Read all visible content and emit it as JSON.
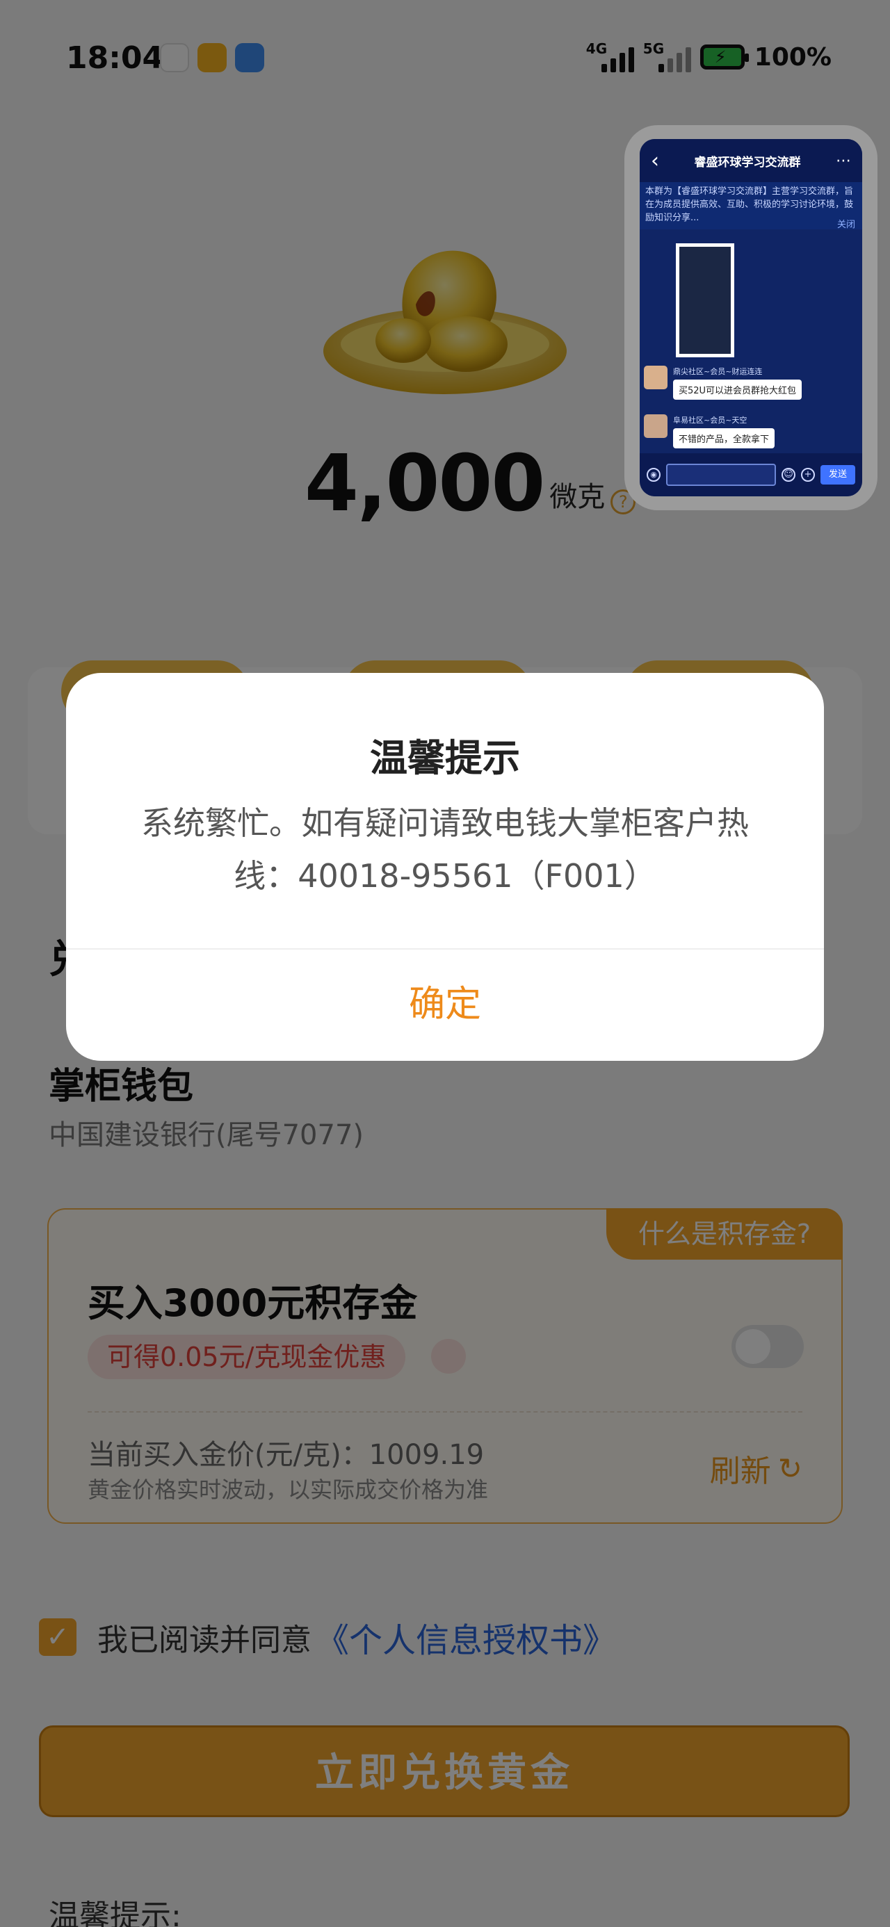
{
  "status_bar": {
    "time": "18:04",
    "network1": "4G",
    "network2": "5G",
    "battery": "100%"
  },
  "hero": {
    "amount": "4,000",
    "unit": "微克",
    "help_symbol": "?"
  },
  "section": {
    "heading": "兑"
  },
  "wallet": {
    "title": "掌柜钱包",
    "bank": "中国建设银行(尾号7077)"
  },
  "promo": {
    "tag": "什么是积存金?",
    "title": "买入3000元积存金",
    "badge": "可得0.05元/克现金优惠",
    "price_line": "当前买入金价(元/克)：1009.19",
    "price_note": "黄金价格实时波动，以实际成交价格为准",
    "refresh": "刷新",
    "toggle_on": false
  },
  "agreement": {
    "checked": true,
    "text": "我已阅读并同意",
    "link": "《个人信息授权书》"
  },
  "exchange_button": "立即兑换黄金",
  "tip_title": "温馨提示:",
  "dialog": {
    "title": "温馨提示",
    "message": "系统繁忙。如有疑问请致电钱大掌柜客户热线：40018-95561（F001）",
    "ok": "确定"
  },
  "pip": {
    "title": "睿盛环球学习交流群",
    "notice": "本群为【睿盛环球学习交流群】主营学习交流群，旨在为成员提供高效、互助、积极的学习讨论环境，鼓励知识分享...",
    "notice_close": "关闭",
    "messages": [
      {
        "name": "鼎尖社区~会员~财运连连",
        "text": "买52U可以进会员群抢大红包"
      },
      {
        "name": "阜易社区~会员~天空",
        "text": "不错的产品，全款拿下"
      }
    ],
    "send": "发送"
  },
  "colors": {
    "accent": "#f2a52a",
    "link": "#2a64d8",
    "dialog_ok": "#ee8a1a",
    "badge_text": "#e0403a"
  }
}
